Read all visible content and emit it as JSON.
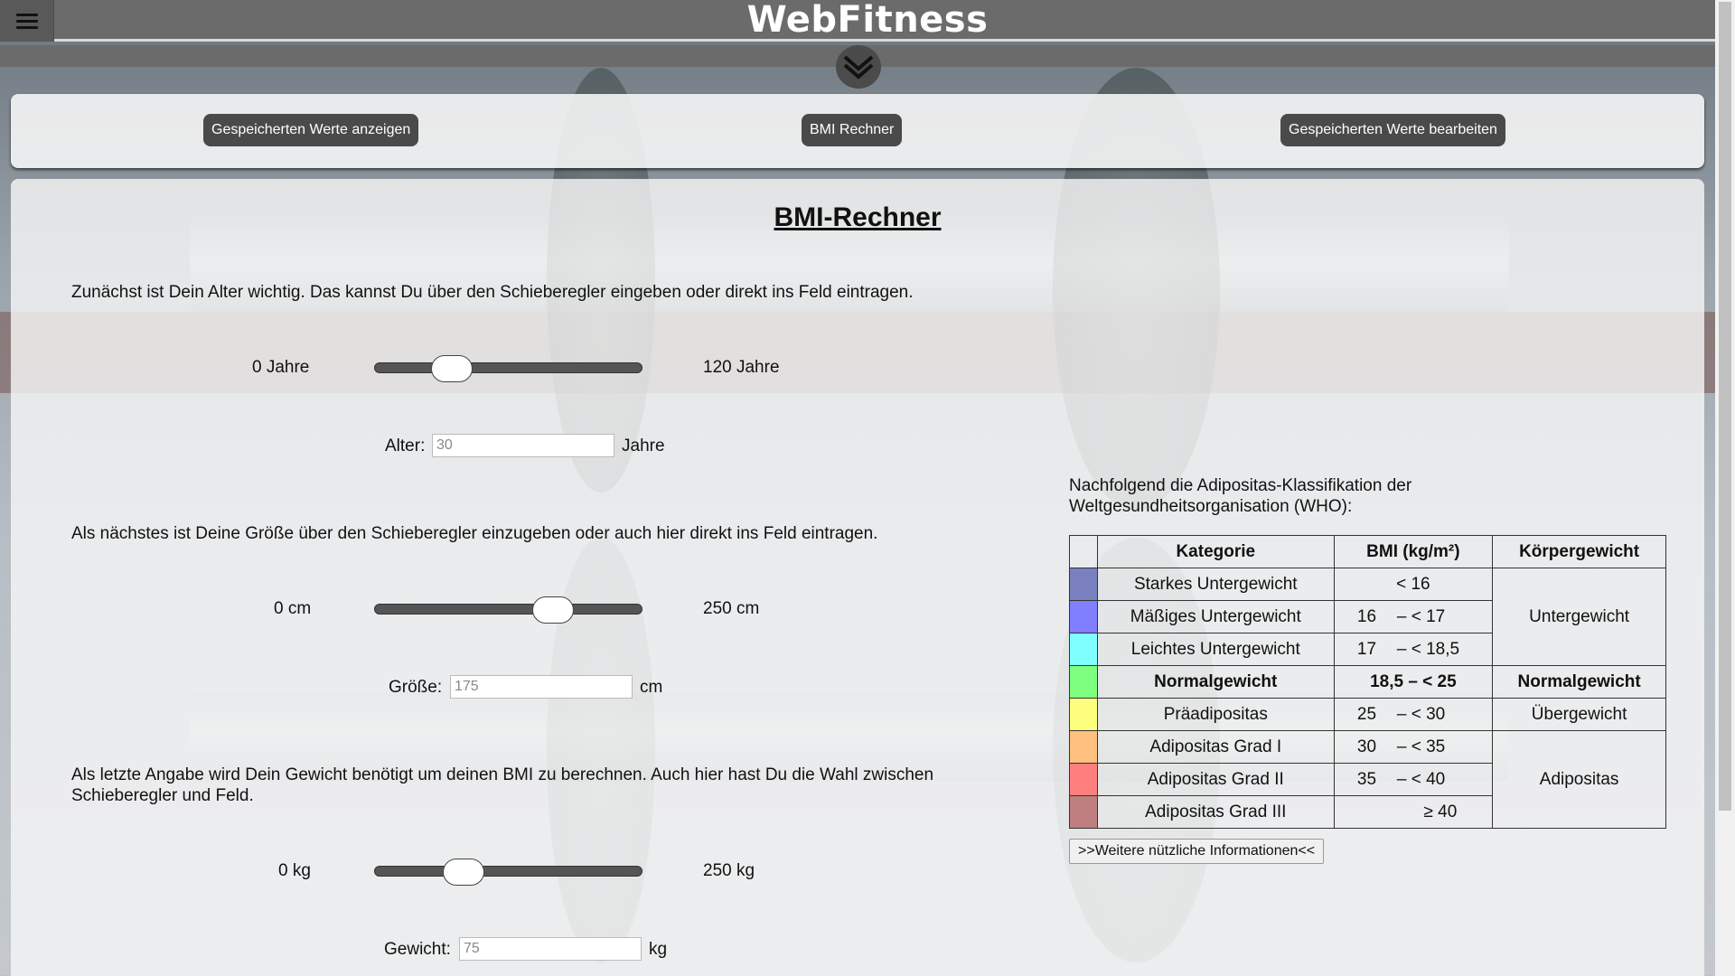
{
  "header": {
    "title": "WebFitness",
    "menu_icon": "hamburger-icon",
    "expand_icon": "double-chevron-down-icon"
  },
  "nav": {
    "buttons": [
      {
        "label": "Gespeicherten Werte anzeigen"
      },
      {
        "label": "BMI Rechner"
      },
      {
        "label": "Gespeicherten Werte bearbeiten"
      }
    ]
  },
  "calculator": {
    "heading": "BMI-Rechner",
    "age": {
      "intro": "Zunächst ist Dein Alter wichtig. Das kannst Du über den Schieberegler eingeben oder direkt ins Feld eintragen.",
      "min_label": "0 Jahre",
      "max_label": "120 Jahre",
      "slider_value": 30,
      "slider_min": 0,
      "slider_max": 120,
      "field_label": "Alter:",
      "field_placeholder": "30",
      "unit": "Jahre"
    },
    "height": {
      "intro": "Als nächstes ist Deine Größe über den Schieberegler einzugeben oder auch hier direkt ins Feld eintragen.",
      "min_label": "0 cm",
      "max_label": "250 cm",
      "slider_value": 175,
      "slider_min": 0,
      "slider_max": 250,
      "field_label": "Größe:",
      "field_placeholder": "175",
      "unit": "cm"
    },
    "weight": {
      "intro": "Als letzte Angabe wird Dein Gewicht benötigt um deinen BMI zu berechnen. Auch hier hast Du die Wahl zwischen Schieberegler und Feld.",
      "min_label": "0 kg",
      "max_label": "250 kg",
      "slider_value": 75,
      "slider_min": 0,
      "slider_max": 250,
      "field_label": "Gewicht:",
      "field_placeholder": "75",
      "unit": "kg"
    }
  },
  "who": {
    "intro": "Nachfolgend die Adipositas-Klassifikation der Weltgesundheitsorganisation (WHO):",
    "headers": [
      "",
      "Kategorie",
      "BMI (kg/m²)",
      "Körpergewicht"
    ],
    "rows": [
      {
        "color": "#7a7fbf",
        "category": "Starkes Untergewicht",
        "bmi_from": "",
        "bmi_to": "< 16"
      },
      {
        "color": "#7f7fff",
        "category": "Mäßiges Untergewicht",
        "bmi_from": "16",
        "bmi_to": "– < 17"
      },
      {
        "color": "#7fffff",
        "category": "Leichtes Untergewicht",
        "bmi_from": "17",
        "bmi_to": "– < 18,5"
      },
      {
        "color": "#7fff7f",
        "category": "Normalgewicht",
        "bmi_from": "18,5 – < 25",
        "bmi_to": ""
      },
      {
        "color": "#ffff7f",
        "category": "Präadipositas",
        "bmi_from": "25",
        "bmi_to": "– < 30"
      },
      {
        "color": "#ffbf7f",
        "category": "Adipositas Grad I",
        "bmi_from": "30",
        "bmi_to": "– < 35"
      },
      {
        "color": "#ff7f7f",
        "category": "Adipositas Grad II",
        "bmi_from": "35",
        "bmi_to": "– < 40"
      },
      {
        "color": "#bf7f7f",
        "category": "Adipositas Grad III",
        "bmi_from": "",
        "bmi_to": "≥ 40"
      }
    ],
    "groups": {
      "under": "Untergewicht",
      "normal": "Normalgewicht",
      "over": "Übergewicht",
      "obese": "Adipositas"
    },
    "more_button": ">>Weitere nützliche Informationen<<"
  }
}
